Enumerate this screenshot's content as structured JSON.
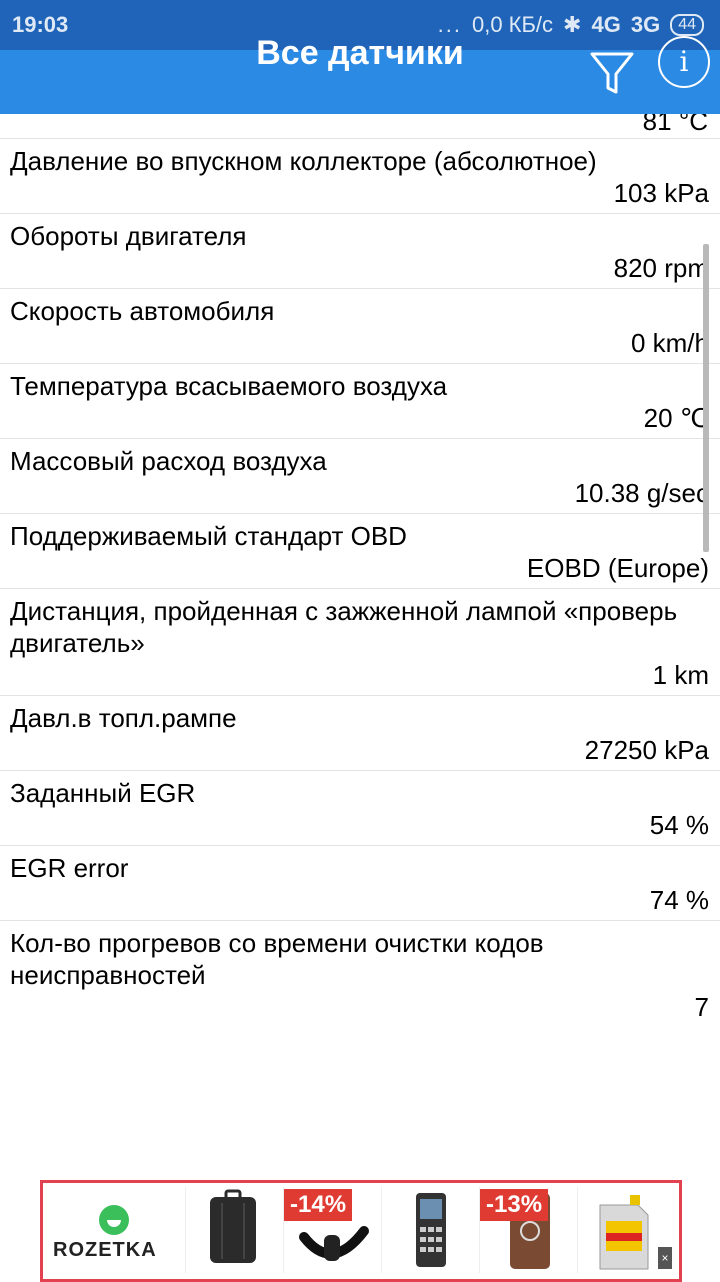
{
  "status_bar": {
    "time": "19:03",
    "dots": "...",
    "network_speed": "0,0 КБ/с",
    "signal1": "4G",
    "signal2": "3G",
    "battery": "44"
  },
  "header": {
    "title": "Все датчики"
  },
  "partial_value": "81 °C",
  "sensors": [
    {
      "name": "Давление во впускном коллекторе (абсолютное)",
      "value": "103 kPa"
    },
    {
      "name": "Обороты двигателя",
      "value": "820 rpm"
    },
    {
      "name": "Скорость автомобиля",
      "value": "0 km/h"
    },
    {
      "name": "Температура всасываемого воздуха",
      "value": "20 ℃"
    },
    {
      "name": "Массовый расход воздуха",
      "value": "10.38 g/sec"
    },
    {
      "name": "Поддерживаемый стандарт OBD",
      "value": "EOBD (Europe)"
    },
    {
      "name": "Дистанция, пройденная с зажженной лампой «проверь двигатель»",
      "value": "1 km"
    },
    {
      "name": "Давл.в топл.рампе",
      "value": "27250 kPa"
    },
    {
      "name": "Заданный EGR",
      "value": "54 %"
    },
    {
      "name": "EGR error",
      "value": "74 %"
    },
    {
      "name": "Кол-во прогревов со времени очистки кодов неисправностей",
      "value": "7"
    }
  ],
  "ad": {
    "brand": "ROZETKA",
    "badges": [
      "-14%",
      "-13%"
    ]
  }
}
